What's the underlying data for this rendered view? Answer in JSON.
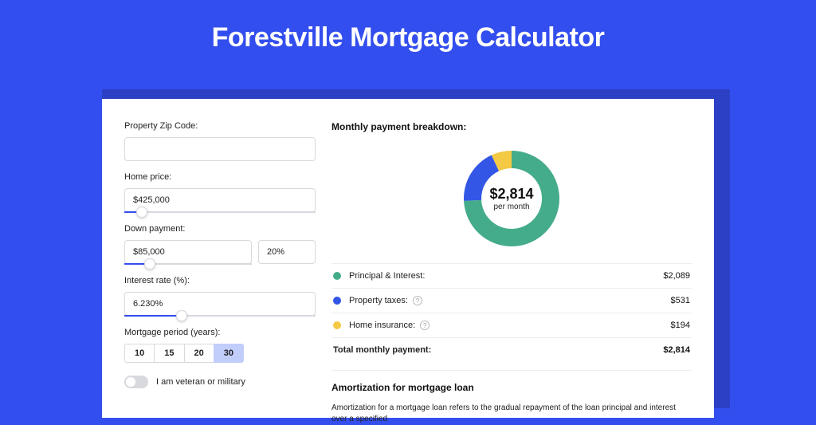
{
  "title": "Forestville Mortgage Calculator",
  "form": {
    "zip": {
      "label": "Property Zip Code:",
      "value": ""
    },
    "price": {
      "label": "Home price:",
      "value": "$425,000",
      "slider_pct": 9
    },
    "down": {
      "label": "Down payment:",
      "value": "$85,000",
      "pct": "20%",
      "slider_pct": 20
    },
    "rate": {
      "label": "Interest rate (%):",
      "value": "6.230%",
      "slider_pct": 30
    },
    "period": {
      "label": "Mortgage period (years):",
      "options": [
        "10",
        "15",
        "20",
        "30"
      ],
      "selected": "30"
    },
    "veteran": {
      "label": "I am veteran or military",
      "on": false
    }
  },
  "breakdown": {
    "title": "Monthly payment breakdown:",
    "center_value": "$2,814",
    "center_sub": "per month",
    "rows": [
      {
        "label": "Principal & Interest:",
        "amount": "$2,089",
        "color": "#45ac8b",
        "help": false
      },
      {
        "label": "Property taxes:",
        "amount": "$531",
        "color": "#3356e6",
        "help": true
      },
      {
        "label": "Home insurance:",
        "amount": "$194",
        "color": "#f4c944",
        "help": true
      }
    ],
    "total": {
      "label": "Total monthly payment:",
      "amount": "$2,814"
    }
  },
  "amort": {
    "title": "Amortization for mortgage loan",
    "text": "Amortization for a mortgage loan refers to the gradual repayment of the loan principal and interest over a specified"
  },
  "chart_data": {
    "type": "pie",
    "title": "Monthly payment breakdown",
    "series": [
      {
        "name": "Principal & Interest",
        "value": 2089,
        "color": "#45ac8b"
      },
      {
        "name": "Property taxes",
        "value": 531,
        "color": "#3356e6"
      },
      {
        "name": "Home insurance",
        "value": 194,
        "color": "#f4c944"
      }
    ],
    "total": 2814,
    "center_label": "$2,814 per month"
  }
}
